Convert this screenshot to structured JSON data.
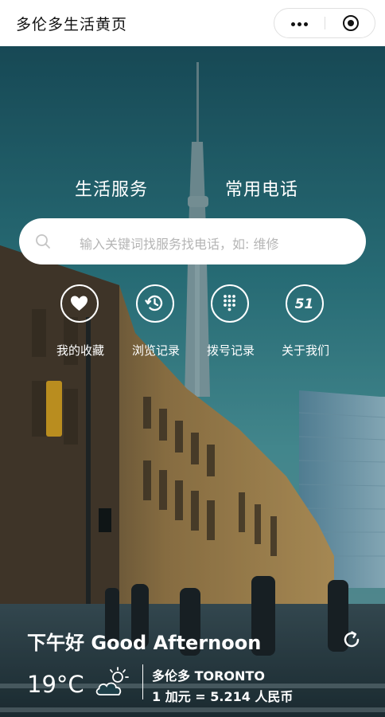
{
  "header": {
    "title": "多伦多生活黄页",
    "more_icon": "more-dots-icon",
    "close_icon": "close-target-icon"
  },
  "tabs": [
    {
      "label": "生活服务"
    },
    {
      "label": "常用电话"
    }
  ],
  "search": {
    "placeholder": "输入关键词找服务找电话，如: 维修",
    "icon": "search-icon"
  },
  "shortcuts": [
    {
      "label": "我的收藏",
      "icon": "heart-icon"
    },
    {
      "label": "浏览记录",
      "icon": "history-icon"
    },
    {
      "label": "拨号记录",
      "icon": "dialpad-icon"
    },
    {
      "label": "关于我们",
      "icon": "logo-51-icon",
      "glyph": "51"
    }
  ],
  "greeting": "下午好 Good Afternoon",
  "weather": {
    "temperature": "19°C",
    "icon": "partly-cloudy-icon",
    "city": "多伦多 TORONTO",
    "exchange_rate": "1 加元 = 5.214 人民币"
  },
  "colors": {
    "sky_top": "#1b5a66",
    "sky_mid": "#3d8b91",
    "building": "#8a6a3c"
  }
}
